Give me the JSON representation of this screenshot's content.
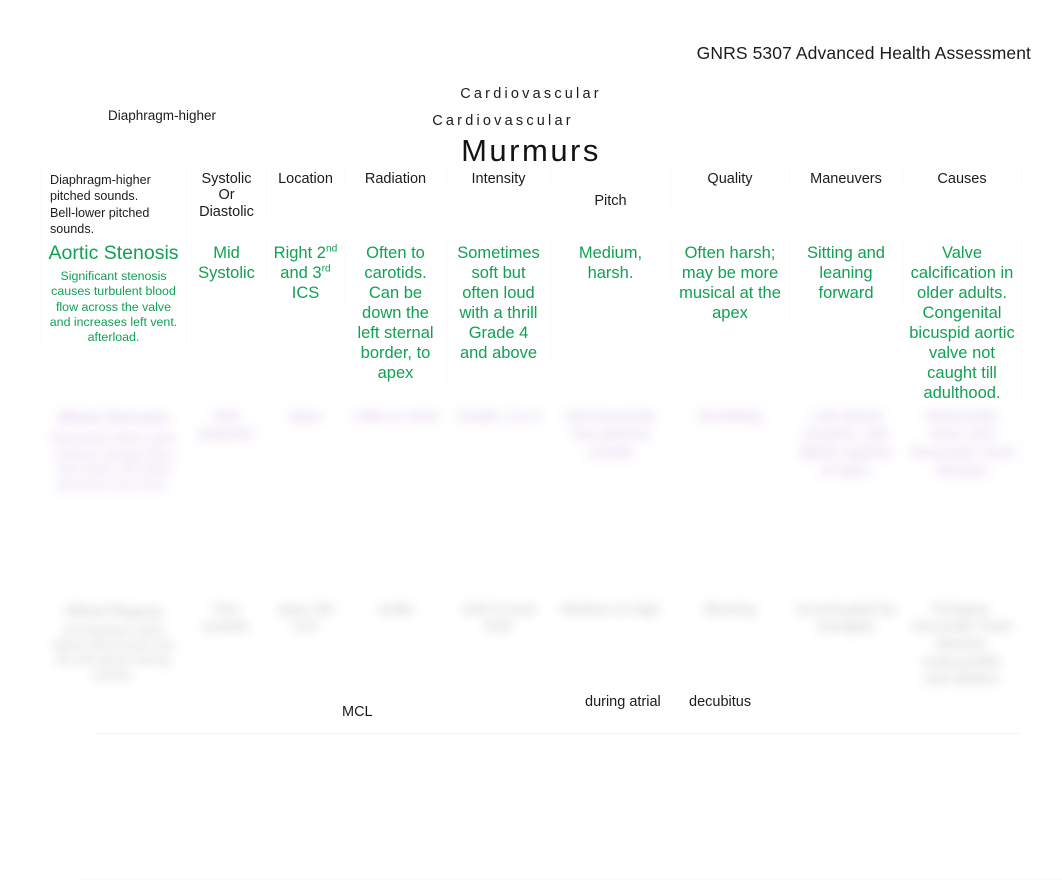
{
  "document": {
    "course_header": "GNRS 5307 Advanced Health Assessment",
    "title_line_1": "Cardiovascular",
    "title_line_2": "Cardiovascular",
    "title_main": "Murmurs",
    "stray_label": "Diaphragm-higher",
    "accent_green": "#12a055",
    "blur_purple": "#9b5fbf",
    "blur_gray": "#4a4a4a"
  },
  "table": {
    "headers": {
      "col0": "Diaphragm-higher pitched sounds. Bell-lower pitched sounds.",
      "col1": "Systolic Or Diastolic",
      "col2": "Location",
      "col3": "Radiation",
      "col4": "Intensity",
      "col5": "Pitch",
      "col6": "Quality",
      "col7": "Maneuvers",
      "col8": "Causes"
    },
    "header_col0_lines": [
      "Diaphragm-higher",
      "pitched sounds.",
      "Bell-lower pitched",
      "sounds."
    ],
    "header_col1_lines": [
      "Systolic",
      "Or",
      "Diastolic"
    ],
    "rows": [
      {
        "name": "aortic-stenosis",
        "style": "green",
        "title": "Aortic Stenosis",
        "subtitle": "Significant stenosis causes turbulent blood flow across the valve and increases left vent. afterload.",
        "systolic_or_diastolic": "Mid Systolic",
        "location_pre": "Right 2",
        "location_sup1": "nd",
        "location_mid": " and 3",
        "location_sup2": "rd",
        "location_post": " ICS",
        "radiation": "Often to carotids. Can be down the left sternal border, to apex",
        "intensity": "Sometimes soft but often loud with a thrill Grade 4 and above",
        "pitch": "Medium, harsh.",
        "quality": "Often harsh; may be more musical at the apex",
        "maneuvers": "Sitting and leaning forward",
        "causes": "Valve calcification in older adults. Congenital bicuspid aortic valve not caught till adulthood."
      },
      {
        "name": "blurred-row-purple",
        "style": "purple-blurred",
        "title": "",
        "subtitle": "",
        "systolic_or_diastolic": "",
        "location": "",
        "radiation": "",
        "intensity": "",
        "pitch": "",
        "quality": "",
        "maneuvers": "",
        "causes": ""
      },
      {
        "name": "blurred-row-gray",
        "style": "gray-blurred",
        "title": "",
        "subtitle": "",
        "systolic_or_diastolic": "",
        "location": "",
        "radiation": "",
        "intensity": "",
        "pitch": "",
        "quality": "",
        "maneuvers": "",
        "causes": ""
      }
    ]
  },
  "fragments": {
    "mcl": "MCL",
    "during_atrial": "during atrial",
    "decubitus": "decubitus"
  }
}
